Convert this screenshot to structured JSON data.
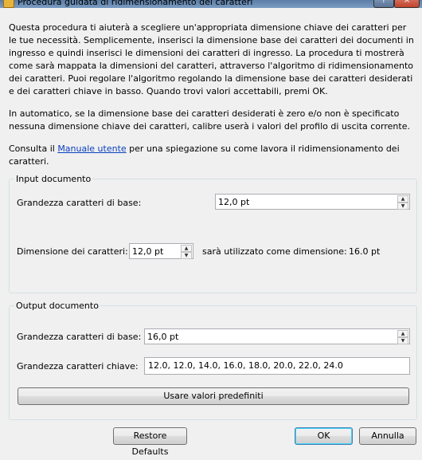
{
  "window": {
    "title": "Procedura guidata di ridimensionamento dei caratteri",
    "help_label": "?",
    "close_label": "×"
  },
  "intro": {
    "p1": "Questa procedura ti aiuterà a scegliere un'appropriata dimensione chiave dei caratteri per le tue necessità. Semplicemente, inserisci la dimensione base dei caratteri dei documenti in ingresso e quindi inserisci le dimensioni dei caratteri di ingresso. La procedura ti mostrerà come sarà mappata la dimensioni del caratteri, attraverso l'algoritmo di ridimensionamento dei caratteri. Puoi regolare l'algoritmo regolando la dimensione base dei caratteri desiderati e dei caratteri chiave in basso. Quando trovi valori accettabili, premi OK.",
    "p2": "In automatico, se la dimensione base dei caratteri desiderati è zero e/o non è specificato nessuna dimensione chiave dei caratteri, calibre userà i valori del profilo di uscita corrente.",
    "p3_before": "Consulta il ",
    "p3_link": "Manuale utente",
    "p3_after": " per una spiegazione su come lavora il ridimensionamento dei caratteri."
  },
  "input_group": {
    "legend": "Input documento",
    "base_label": "Grandezza caratteri di base:",
    "base_value": "12,0 pt",
    "size_label": "Dimensione dei caratteri:",
    "size_value": "12,0 pt",
    "result_label": "sarà utilizzato come dimensione:",
    "result_value": "16.0 pt"
  },
  "output_group": {
    "legend": "Output documento",
    "base_label": "Grandezza caratteri di base:",
    "base_value": "16,0 pt",
    "key_label": "Grandezza caratteri chiave:",
    "key_value": "12.0, 12.0, 14.0, 16.0, 18.0, 20.0, 22.0, 24.0",
    "defaults_button": "Usare valori predefiniti"
  },
  "footer": {
    "restore_button": "Restore Defaults",
    "ok_button": "OK",
    "cancel_button": "Annulla"
  }
}
